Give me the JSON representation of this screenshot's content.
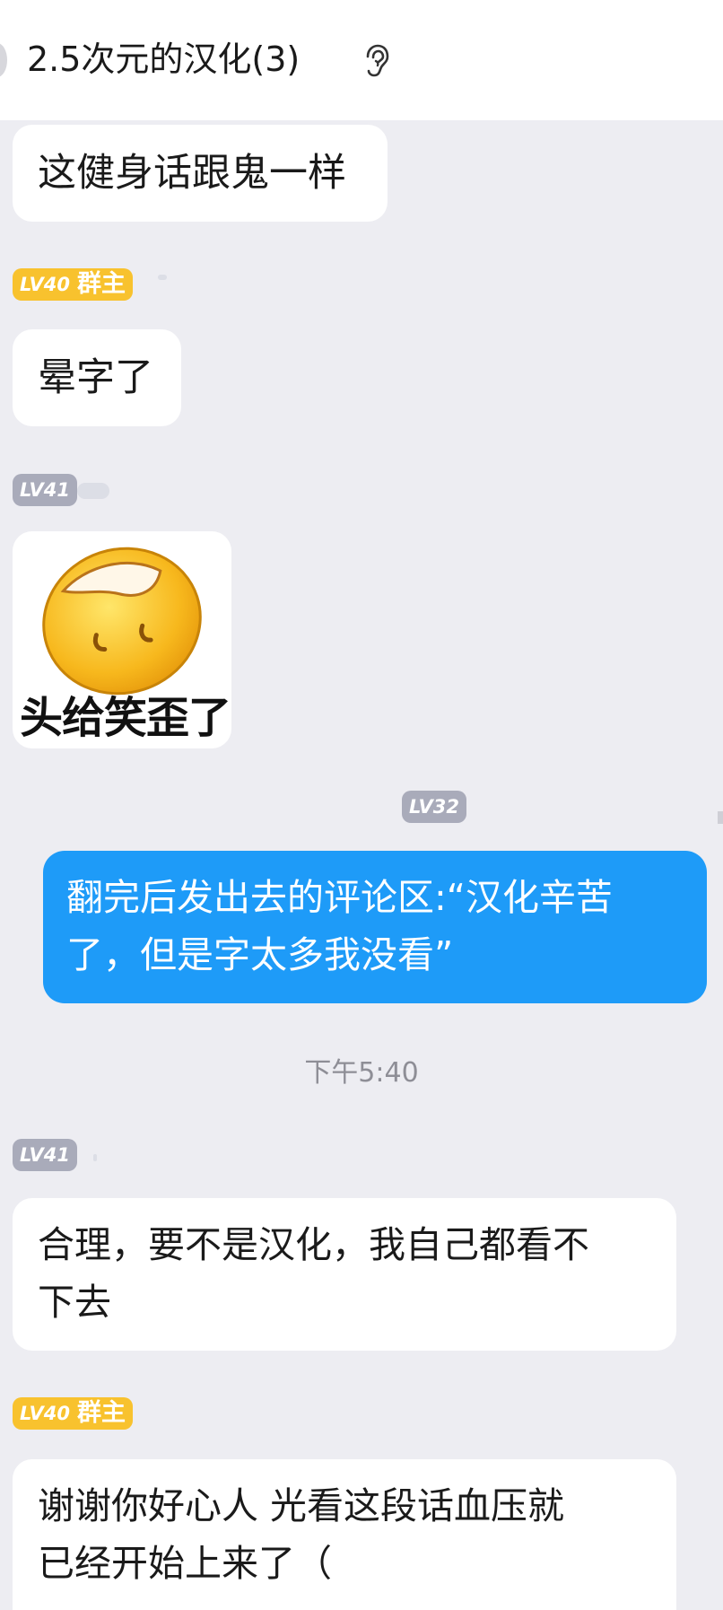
{
  "header": {
    "title": "2.5次元的汉化(3)",
    "icons": [
      "back-icon",
      "ear-icon"
    ]
  },
  "messages": [
    {
      "text": "这健身话跟鬼一样"
    },
    {
      "badge": {
        "level": "LV40",
        "role": "群主"
      },
      "text": "晕字了"
    },
    {
      "badge": {
        "level": "LV41"
      },
      "sticker_caption": "头给笑歪了"
    },
    {
      "badge": {
        "level": "LV32"
      },
      "text_lines": [
        "翻完后发出去的评论区:“汉化辛苦",
        "了，但是字太多我没看”"
      ]
    },
    {
      "badge": {
        "level": "LV41"
      },
      "text_lines": [
        "合理，要不是汉化，我自己都看不",
        "下去"
      ]
    },
    {
      "badge": {
        "level": "LV40",
        "role": "群主"
      },
      "text_lines": [
        "谢谢你好心人 光看这段话血压就",
        "已经开始上来了（"
      ]
    }
  ],
  "timestamp": "下午5:40",
  "colors": {
    "background": "#ededf2",
    "self_bubble": "#1e9bf8",
    "owner_badge": "#f8c22e",
    "member_badge": "#a9abba"
  }
}
